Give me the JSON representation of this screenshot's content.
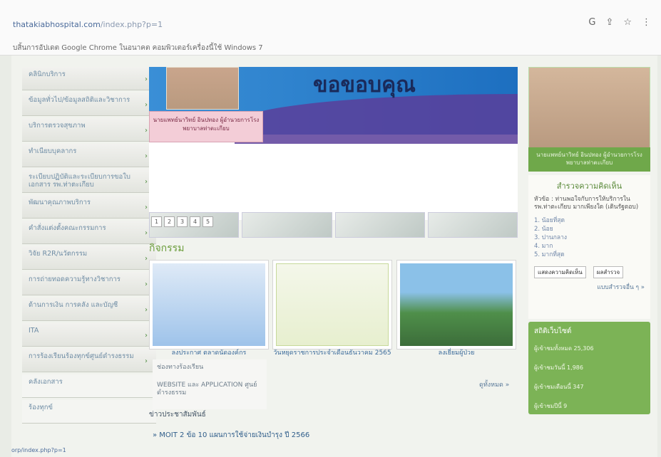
{
  "browser": {
    "url_host": "thatakiabhospital.com",
    "url_path": "/index.php?p=1",
    "icons": [
      "G",
      "share-icon",
      "star-icon",
      "menu-icon"
    ],
    "notice": "บสิ้นการอัปเดต Google Chrome ในอนาคต คอมพิวเตอร์เครื่องนี้ใช้ Windows 7"
  },
  "sidebar": {
    "items": [
      {
        "label": "คลินิกบริการ"
      },
      {
        "label": "ข้อมูลทั่วไป/ข้อมูลสถิติและวิชาการ"
      },
      {
        "label": "บริการตรวจสุขภาพ"
      },
      {
        "label": "ทำเนียบบุคลากร"
      },
      {
        "label": "ระเบียบปฏิบัติและระเบียบการขอใบเอกสาร รพ.ท่าตะเกียบ"
      },
      {
        "label": "พัฒนาคุณภาพบริการ"
      },
      {
        "label": "คำสั่งแต่งตั้งคณะกรรมการ"
      },
      {
        "label": "วิจัย R2R/นวัตกรรม"
      },
      {
        "label": "การถ่ายทอดความรู้ทางวิชาการ"
      },
      {
        "label": "ด้านการเงิน การคลัง และบัญชี"
      },
      {
        "label": "ITA"
      },
      {
        "label": "การร้องเรียนร้องทุกข์ศูนย์ดำรงธรรม"
      },
      {
        "label": "คลังเอกสาร"
      },
      {
        "label": "ร้องทุกข์"
      }
    ]
  },
  "banner": {
    "title": "ขอขอบคุณ",
    "caption": "นายแพทย์นาวิทย์ อินปทอง ผู้อำนวยการโรงพยาบาลท่าตะเกียบ",
    "pager": [
      "1",
      "2",
      "3",
      "4",
      "5"
    ]
  },
  "activities": {
    "title": "กิจกรรม",
    "cards": [
      {
        "label": "ลงประกาศ ตลาดนัดองค์กร"
      },
      {
        "label": "วันหยุดราชการประจำเดือนธันวาคม 2565"
      },
      {
        "label": "ลงเยี่ยมผู้ป่วย"
      }
    ],
    "more": "ดูทั้งหมด »"
  },
  "dropdown": {
    "items": [
      "ช่องทางร้องเรียน",
      "WEBSITE และ APPLICATION ศูนย์ดำรงธรรม"
    ]
  },
  "bottom": {
    "section_text": "ข่าวประชาสัมพันธ์",
    "link": "» MOIT 2 ข้อ 10 แผนการใช้จ่ายเงินบำรุง ปี 2566"
  },
  "right": {
    "caption": "นายแพทย์นาวิทย์ อินปทอง ผู้อำนวยการโรงพยาบาลท่าตะเกียบ",
    "poll": {
      "title": "สำรวจความคิดเห็น",
      "question": "หัวข้อ : ท่านพอใจกับการให้บริการใน รพ.ท่าตะเกียบ มากเพียงใด (เดินรัฐตอบ)",
      "options": [
        "1. น้อยที่สุด",
        "2. น้อย",
        "3. ปานกลาง",
        "4. มาก",
        "5. มากที่สุด"
      ],
      "btn_view": "แสดงความคิดเห็น",
      "btn_result": "ผลสำรวจ",
      "more": "แบบสำรวจอื่น ๆ »"
    },
    "stats": {
      "title": "สถิติเว็บไซต์",
      "rows": [
        "ผู้เข้าชมทั้งหมด 25,306",
        "ผู้เข้าชมวันนี้ 1,986",
        "ผู้เข้าชมเดือนนี้ 347",
        "ผู้เข้าชมปีนี้ 9"
      ]
    }
  },
  "status_url": "orp/index.php?p=1"
}
